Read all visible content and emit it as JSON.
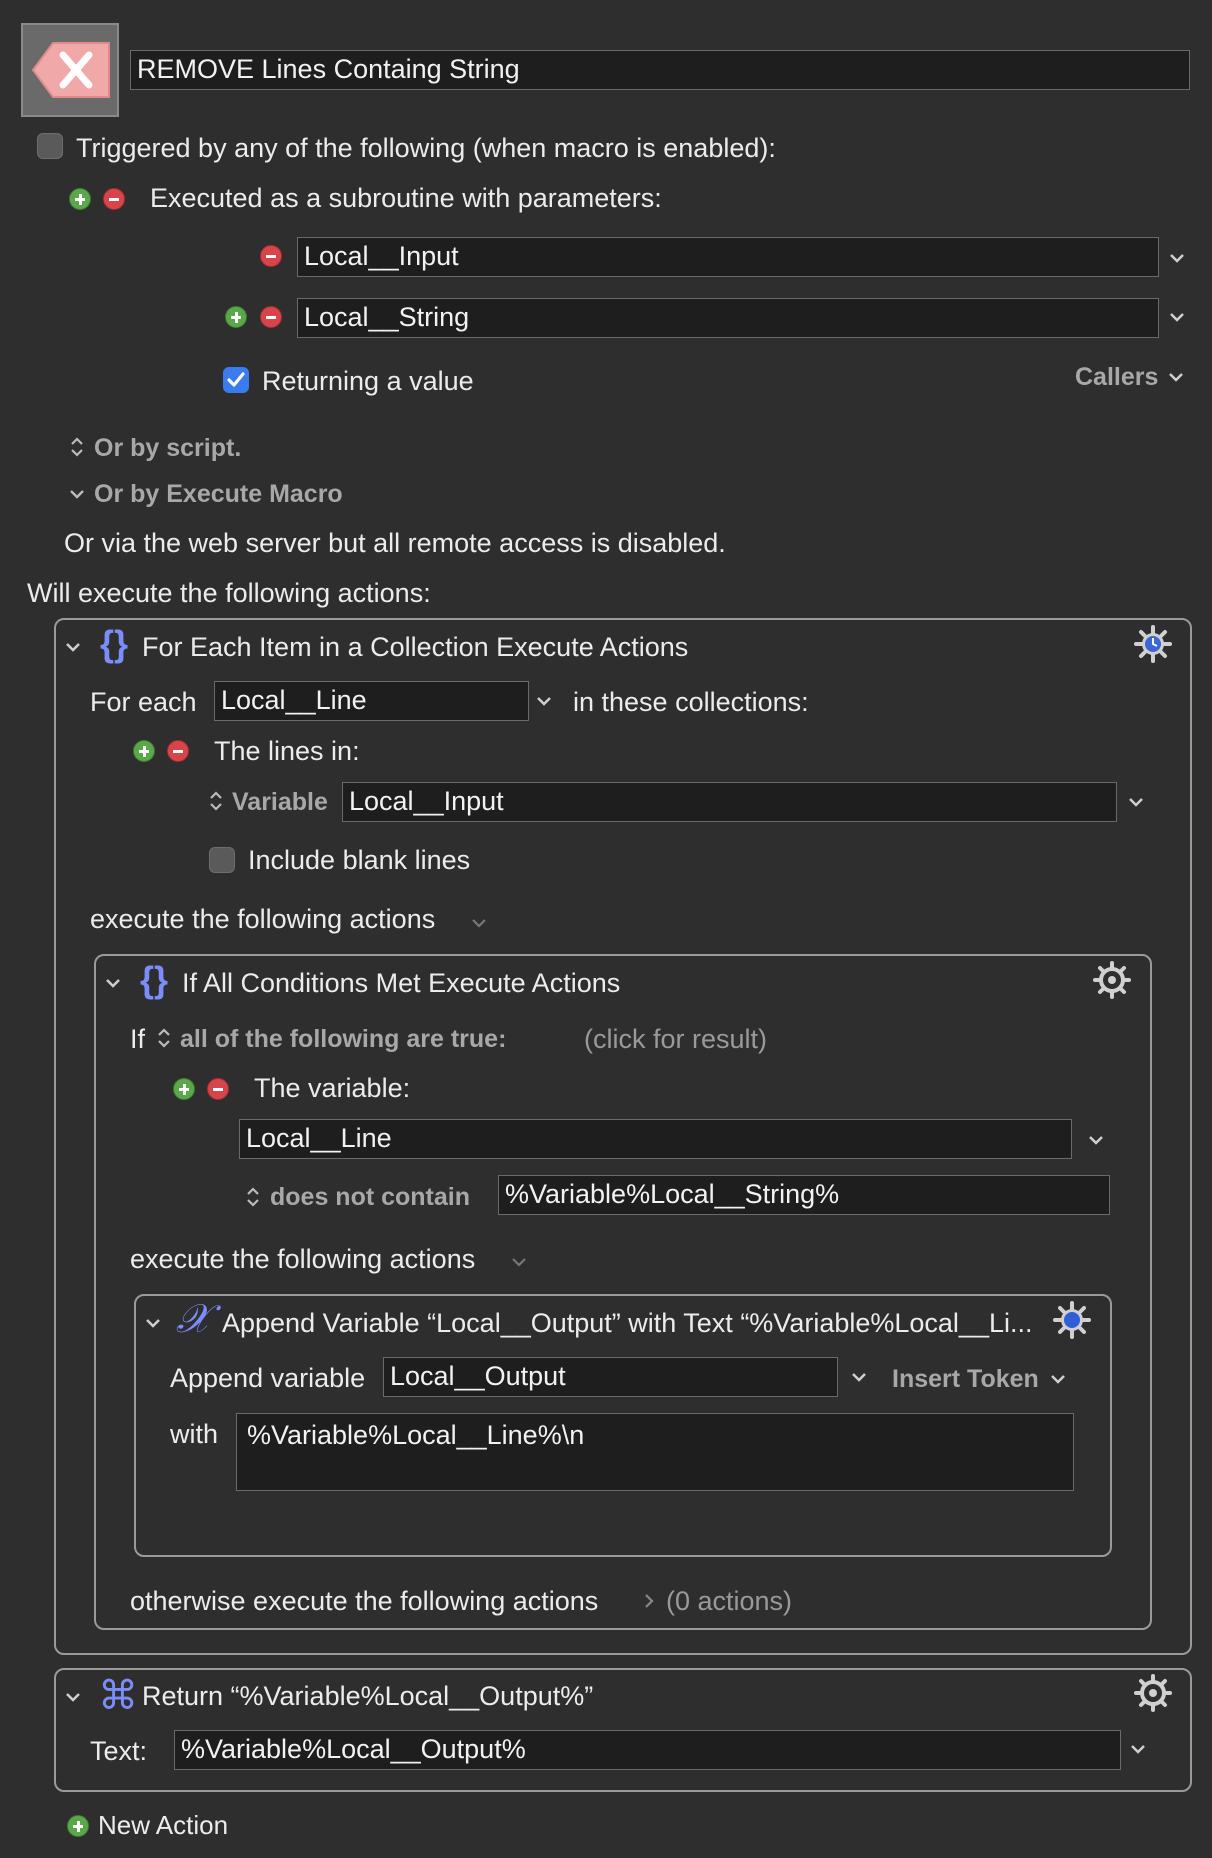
{
  "macro": {
    "name": "REMOVE Lines Containg String",
    "trigger_label": "Triggered by any of the following (when macro is enabled):",
    "subroutine_label": "Executed as a subroutine with parameters:",
    "params": [
      "Local__Input",
      "Local__String"
    ],
    "returning_label": "Returning a value",
    "callers_label": "Callers",
    "by_script": "Or by script.",
    "by_execute_macro": "Or by Execute Macro",
    "web_server": "Or via the web server but all remote access is disabled.",
    "will_execute": "Will execute the following actions:"
  },
  "foreach": {
    "title": "For Each Item in a Collection Execute Actions",
    "for_each_label": "For each",
    "var": "Local__Line",
    "in_collections": "in these collections:",
    "lines_in": "The lines in:",
    "variable_label": "Variable",
    "variable_value": "Local__Input",
    "include_blank": "Include blank lines",
    "execute_label": "execute the following actions"
  },
  "ifblock": {
    "title": "If All Conditions Met Execute Actions",
    "if_label": "If",
    "all_true": "all of the following are true:",
    "click_result": "(click for result)",
    "the_variable": "The variable:",
    "variable_value": "Local__Line",
    "does_not_contain": "does not contain",
    "contain_value": "%Variable%Local__String%",
    "execute_label": "execute the following actions",
    "otherwise_label": "otherwise execute the following actions",
    "otherwise_count": "(0 actions)"
  },
  "append": {
    "title": "Append Variable “Local__Output” with Text “%Variable%Local__Li...",
    "append_label": "Append variable",
    "var": "Local__Output",
    "insert_token": "Insert Token",
    "with_label": "with",
    "with_value": "%Variable%Local__Line%\\n"
  },
  "return": {
    "title": "Return “%Variable%Local__Output%”",
    "text_label": "Text:",
    "text_value": "%Variable%Local__Output%"
  },
  "new_action": "New Action",
  "colors": {
    "background": "#2e2e2e",
    "accent_blue": "#3a7bf0",
    "brace_purple": "#7b8cff",
    "plus_green": "#5aa84a",
    "minus_red": "#d7454a"
  }
}
